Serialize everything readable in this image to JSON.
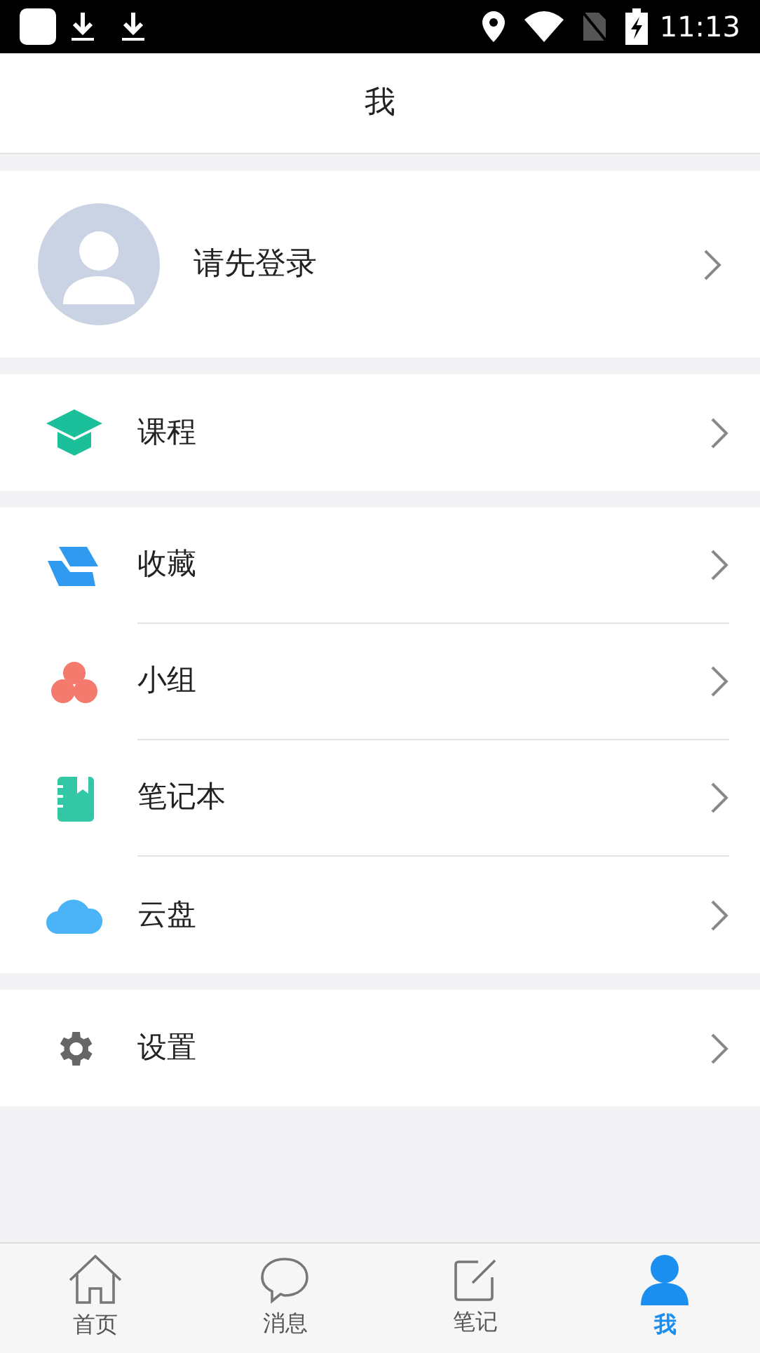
{
  "status_bar": {
    "time": "11:13"
  },
  "header": {
    "title": "我"
  },
  "profile": {
    "name": "请先登录"
  },
  "sections": [
    [
      {
        "kind": "course",
        "label": "课程"
      }
    ],
    [
      {
        "kind": "favorites",
        "label": "收藏"
      },
      {
        "kind": "group",
        "label": "小组"
      },
      {
        "kind": "notebook",
        "label": "笔记本"
      },
      {
        "kind": "cloud",
        "label": "云盘"
      }
    ],
    [
      {
        "kind": "settings",
        "label": "设置"
      }
    ]
  ],
  "tabs": [
    {
      "kind": "home",
      "label": "首页",
      "selected": false
    },
    {
      "kind": "messages",
      "label": "消息",
      "selected": false
    },
    {
      "kind": "notes",
      "label": "笔记",
      "selected": false
    },
    {
      "kind": "me",
      "label": "我",
      "selected": true
    }
  ]
}
